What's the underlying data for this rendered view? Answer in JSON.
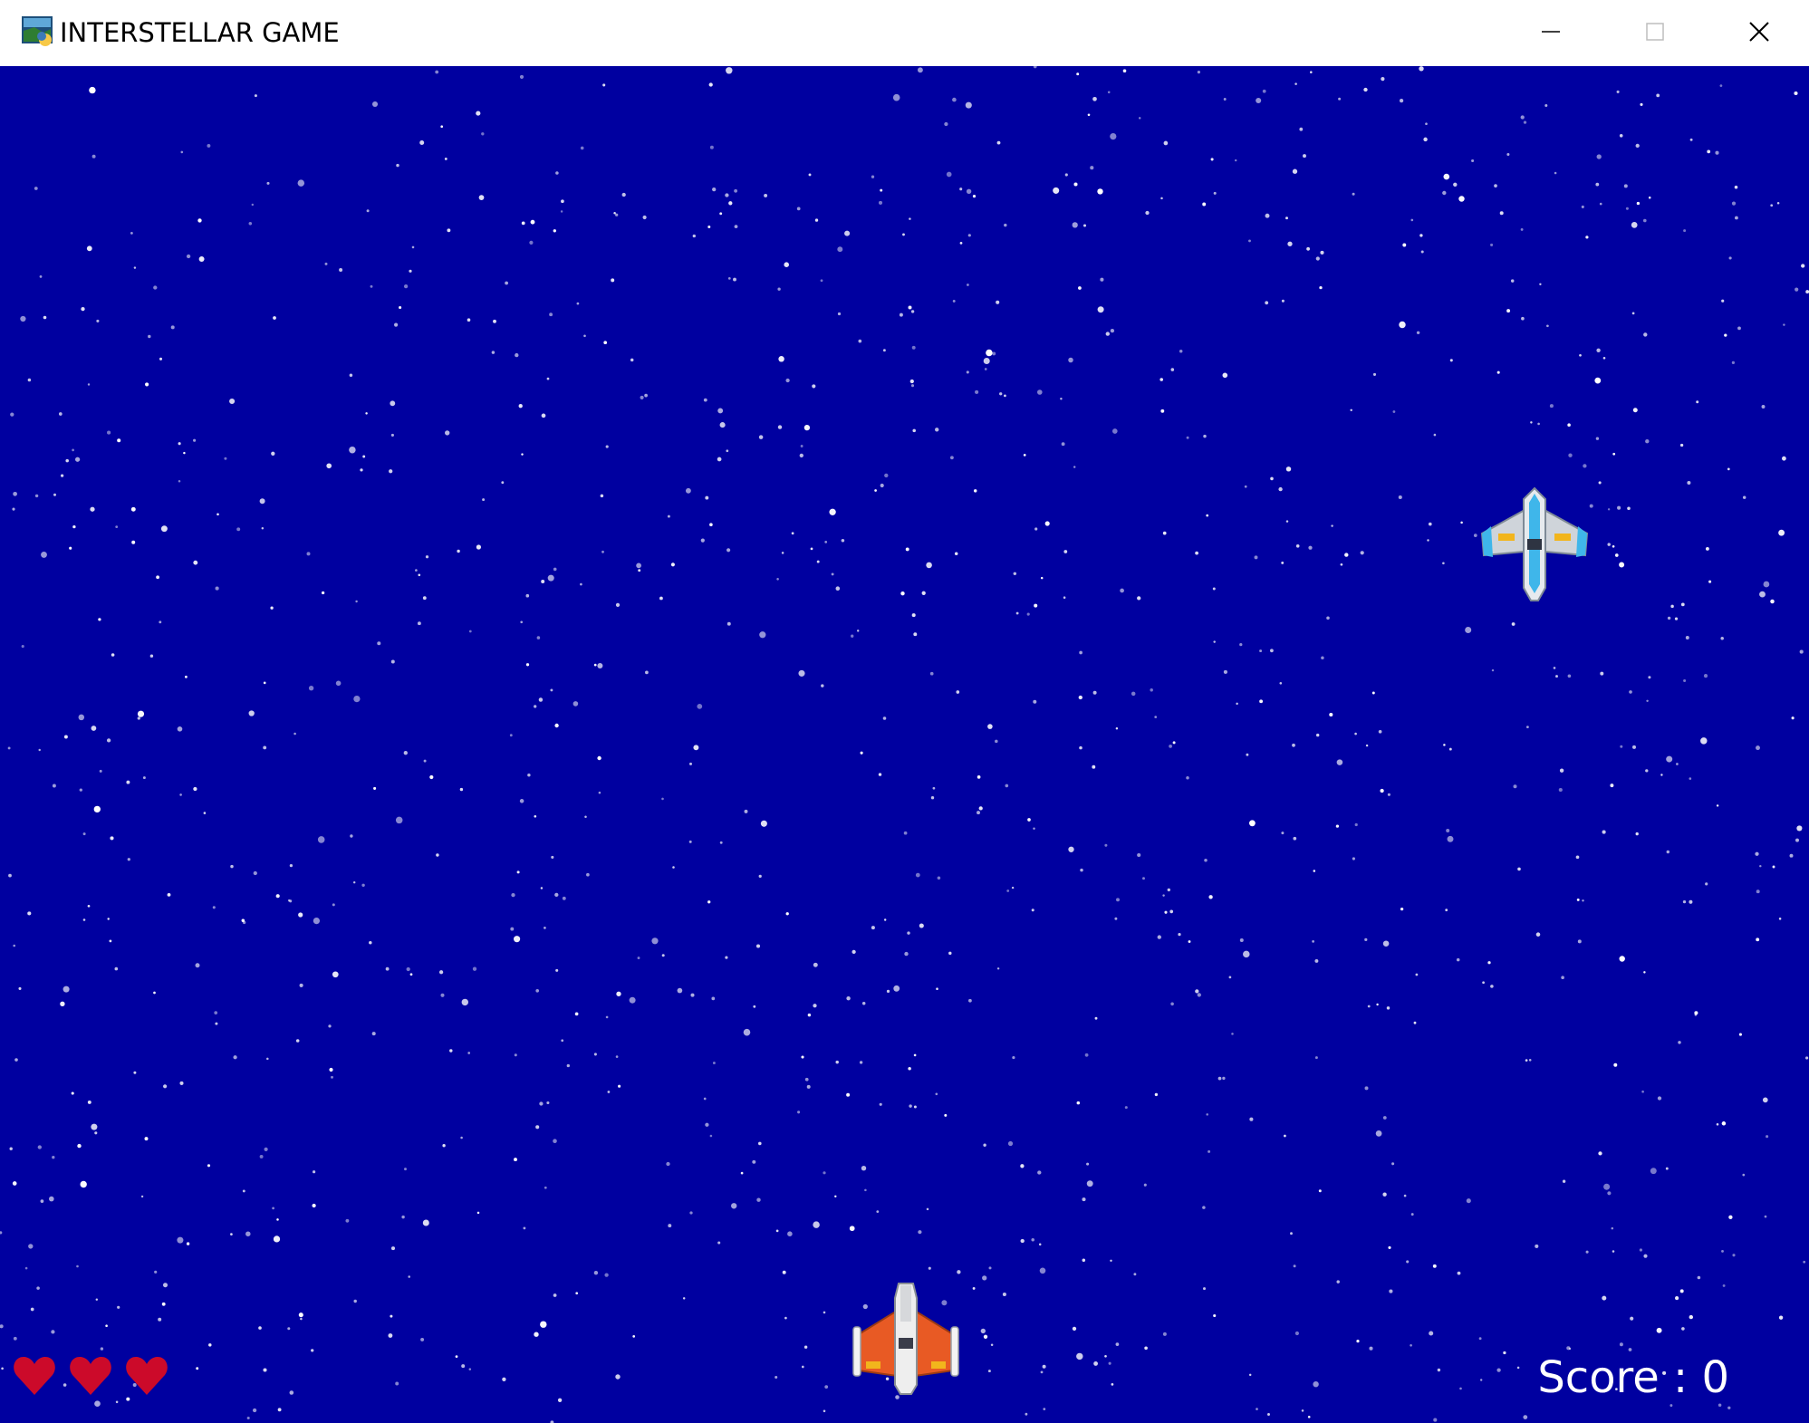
{
  "window": {
    "title": "INTERSTELLAR GAME",
    "icon": "python-window-icon",
    "controls": {
      "minimize": "minimize-icon",
      "maximize": "maximize-icon",
      "close": "close-icon"
    }
  },
  "game": {
    "background_color": "#0000a0",
    "star_color": "#ffffff",
    "score_label": "Score : 0",
    "lives": 3,
    "heart_color": "#cc0a2a",
    "enemy_ship": {
      "name": "enemy-spaceship",
      "accent": "#3fb6ea"
    },
    "player_ship": {
      "name": "player-spaceship",
      "accent": "#e85a24"
    }
  }
}
